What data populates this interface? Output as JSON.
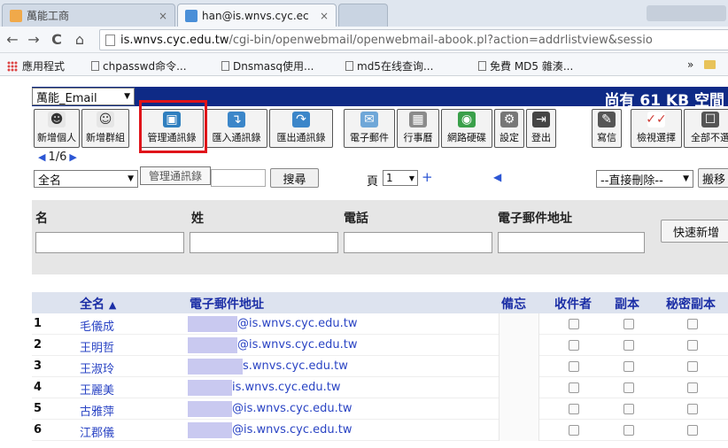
{
  "browser": {
    "tabs": [
      {
        "title": "萬能工商",
        "close": "×"
      },
      {
        "title": "han@is.wnvs.cyc.ec",
        "close": "×"
      }
    ],
    "url_host": "is.wnvs.cyc.edu.tw",
    "url_path": "/cgi-bin/openwebmail/openwebmail-abook.pl?action=addrlistview&sessio",
    "bookmarks": [
      "應用程式",
      "chpasswd命令...",
      "Dnsmasq使用...",
      "md5在线查询...",
      "免費 MD5 雜湊..."
    ],
    "bookmarks_overflow": "»"
  },
  "mail": {
    "folder": "萬能_Email",
    "quota_prefix": "尚有",
    "quota_value": "61 KB",
    "quota_suffix": "空間",
    "toolbar": [
      {
        "label": "新增個人",
        "icon": "add-person-icon",
        "color": "#4a4a4a"
      },
      {
        "label": "新增群組",
        "icon": "add-group-icon",
        "color": "#4a4a4a"
      },
      {
        "label": "管理通訊錄",
        "icon": "address-book-icon",
        "color": "#2f7fbf"
      },
      {
        "label": "匯入通訊錄",
        "icon": "import-icon",
        "color": "#3b86c9"
      },
      {
        "label": "匯出通訊錄",
        "icon": "export-icon",
        "color": "#3b86c9"
      },
      {
        "label": "電子郵件",
        "icon": "mail-icon",
        "color": "#6fa7d8"
      },
      {
        "label": "行事曆",
        "icon": "calendar-icon",
        "color": "#8b8b8b"
      },
      {
        "label": "網路硬碟",
        "icon": "web-disk-icon",
        "color": "#3aa04a"
      },
      {
        "label": "設定",
        "icon": "settings-icon",
        "color": "#777777"
      },
      {
        "label": "登出",
        "icon": "logout-icon",
        "color": "#444444"
      },
      {
        "label": "寫信",
        "icon": "compose-icon",
        "color": "#555555"
      },
      {
        "label": "檢視選擇",
        "icon": "view-selected-icon",
        "color": "#d0403a"
      },
      {
        "label": "全部不選",
        "icon": "unselect-all-icon",
        "color": "#555555"
      }
    ],
    "pager_text": "1/6",
    "search_field": "全名",
    "tooltip": "管理通訊錄",
    "search_button": "搜尋",
    "page_label": "頁",
    "page_value": "1",
    "plus": "+",
    "delete_select": "--直接刪除--",
    "move_button": "搬移"
  },
  "quickadd": {
    "labels": [
      "名",
      "姓",
      "電話",
      "電子郵件地址"
    ],
    "button": "快速新增"
  },
  "table": {
    "headers": {
      "fullname": "全名",
      "email": "電子郵件地址",
      "memo": "備忘",
      "to": "收件者",
      "cc": "副本",
      "bcc": "秘密副本"
    },
    "rows": [
      {
        "num": "1",
        "name": "毛儀成",
        "email": "@is.wnvs.cyc.edu.tw"
      },
      {
        "num": "2",
        "name": "王明哲",
        "email": "@is.wnvs.cyc.edu.tw"
      },
      {
        "num": "3",
        "name": "王淑玲",
        "email": "s.wnvs.cyc.edu.tw"
      },
      {
        "num": "4",
        "name": "王麗美",
        "email": "is.wnvs.cyc.edu.tw"
      },
      {
        "num": "5",
        "name": "古雅萍",
        "email": "@is.wnvs.cyc.edu.tw"
      },
      {
        "num": "6",
        "name": "江郡儀",
        "email": "@is.wnvs.cyc.edu.tw"
      }
    ]
  }
}
